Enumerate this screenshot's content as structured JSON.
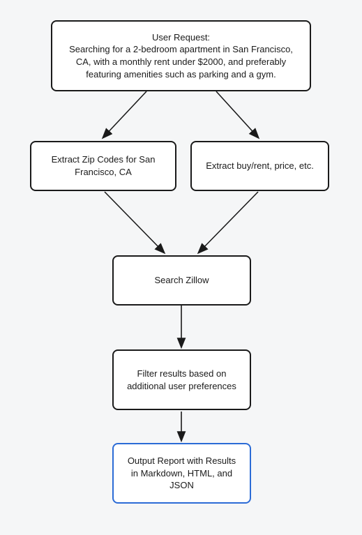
{
  "diagram": {
    "nodes": {
      "user_request": {
        "title": "User Request:",
        "body": "Searching for a 2-bedroom apartment in San Francisco, CA, with a monthly rent under $2000, and preferably featuring amenities such as parking and a gym."
      },
      "extract_zip": "Extract Zip Codes for San Francisco, CA",
      "extract_params": "Extract buy/rent, price, etc.",
      "search_zillow": "Search Zillow",
      "filter_results": "Filter results based on additional user preferences",
      "output_report": "Output Report with Results in Markdown, HTML, and JSON"
    }
  }
}
